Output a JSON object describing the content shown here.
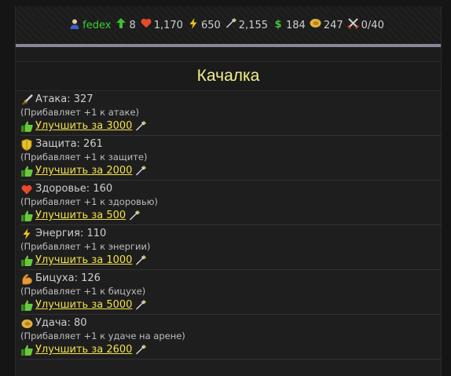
{
  "stats": {
    "username": "fedex",
    "level": "8",
    "health": "1,170",
    "energy": "650",
    "vodka": "2,155",
    "money": "184",
    "luck": "247",
    "fights": "0/40"
  },
  "page": {
    "title": "Качалка"
  },
  "items": [
    {
      "label": "Атака: 327",
      "desc": "(Прибавляет +1 к атаке)",
      "upgrade": "Улучшить за 3000",
      "icon": "sword-icon"
    },
    {
      "label": "Защита: 261",
      "desc": "(Прибавляет +1 к защите)",
      "upgrade": "Улучшить за 2000",
      "icon": "shield-icon"
    },
    {
      "label": "Здоровье: 160",
      "desc": "(Прибавляет +1 к здоровью)",
      "upgrade": "Улучшить за 500",
      "icon": "heart-icon"
    },
    {
      "label": "Энергия: 110",
      "desc": "(Прибавляет +1 к энергии)",
      "upgrade": "Улучшить за 1000",
      "icon": "lightning-icon"
    },
    {
      "label": "Бицуха: 126",
      "desc": "(Прибавляет +1 к бицухе)",
      "upgrade": "Улучшить за 5000",
      "icon": "bicep-icon"
    },
    {
      "label": "Удача: 80",
      "desc": "(Прибавляет +1 к удаче на арене)",
      "upgrade": "Улучшить за 2600",
      "icon": "horseshoe-icon"
    }
  ]
}
